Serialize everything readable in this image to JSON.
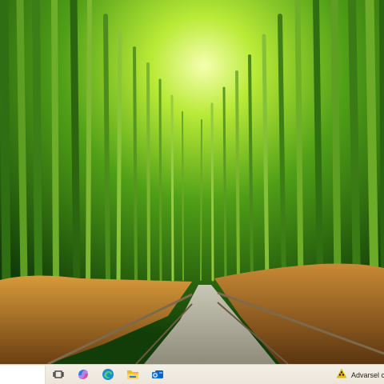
{
  "desktop": {
    "wallpaper": "bamboo-forest-path"
  },
  "taskbar": {
    "search": {
      "value": ""
    },
    "icons": [
      {
        "name": "task-view-icon"
      },
      {
        "name": "copilot-icon"
      },
      {
        "name": "edge-browser-icon"
      },
      {
        "name": "file-explorer-icon"
      },
      {
        "name": "outlook-icon"
      }
    ],
    "notification": {
      "icon": "warning-icon",
      "text": "Advarsel c"
    }
  },
  "colors": {
    "taskbar_bg": "#efe9de",
    "accent_warning": "#e6b800"
  }
}
